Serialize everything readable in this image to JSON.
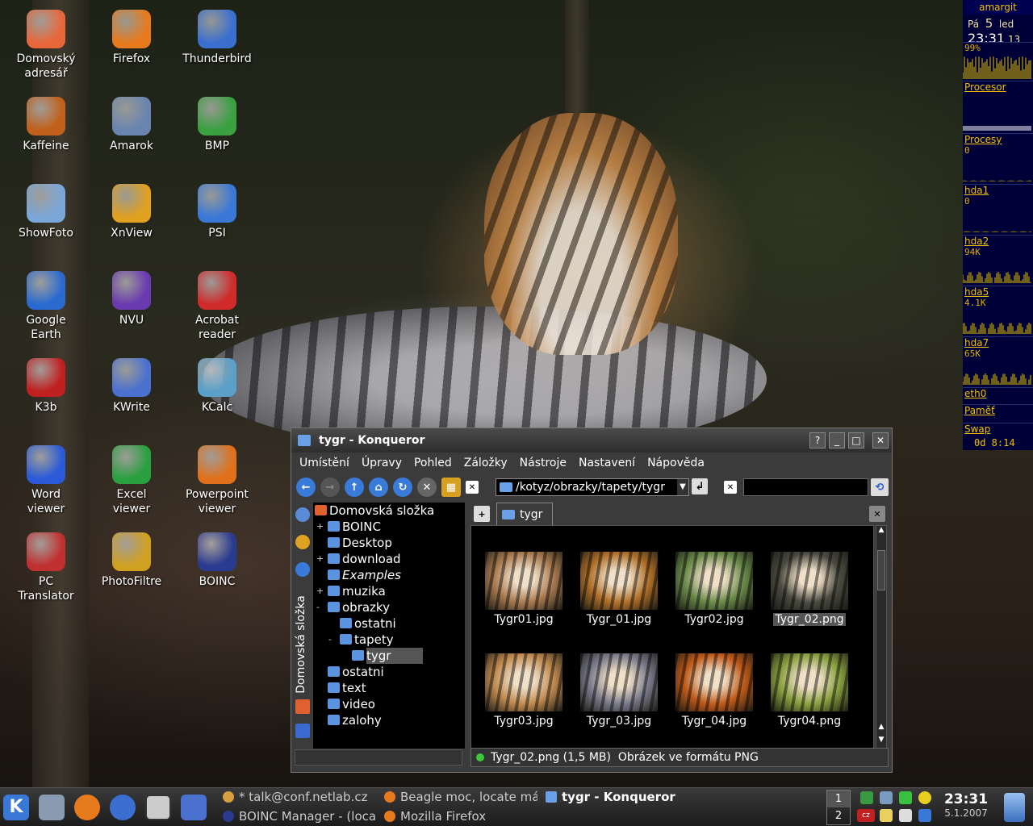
{
  "desktop": {
    "icons": [
      {
        "label": "Domovský\nadresář",
        "icon": "home-icon",
        "color": "#e8673a"
      },
      {
        "label": "Firefox",
        "icon": "firefox-icon",
        "color": "#e87a1e"
      },
      {
        "label": "Thunderbird",
        "icon": "thunderbird-icon",
        "color": "#3a6fd0"
      },
      {
        "label": "Kaffeine",
        "icon": "kaffeine-icon",
        "color": "#c0601a"
      },
      {
        "label": "Amarok",
        "icon": "amarok-icon",
        "color": "#6a84b0"
      },
      {
        "label": "BMP",
        "icon": "bmp-icon",
        "color": "#3aa040"
      },
      {
        "label": "ShowFoto",
        "icon": "showfoto-icon",
        "color": "#7aa6d8"
      },
      {
        "label": "XnView",
        "icon": "xnview-icon",
        "color": "#e0a020"
      },
      {
        "label": "PSI",
        "icon": "psi-icon",
        "color": "#3a78d8"
      },
      {
        "label": "Google\nEarth",
        "icon": "google-earth-icon",
        "color": "#2a6ad0"
      },
      {
        "label": "NVU",
        "icon": "nvu-icon",
        "color": "#6a3ab0"
      },
      {
        "label": "Acrobat\nreader",
        "icon": "acrobat-icon",
        "color": "#d02a2a"
      },
      {
        "label": "K3b",
        "icon": "k3b-icon",
        "color": "#c02020"
      },
      {
        "label": "KWrite",
        "icon": "kwrite-icon",
        "color": "#4a70d0"
      },
      {
        "label": "KCalc",
        "icon": "kcalc-icon",
        "color": "#5aa0c8"
      },
      {
        "label": "Word\nviewer",
        "icon": "word-viewer-icon",
        "color": "#2a5ad8"
      },
      {
        "label": "Excel\nviewer",
        "icon": "excel-viewer-icon",
        "color": "#2aa040"
      },
      {
        "label": "Powerpoint\nviewer",
        "icon": "powerpoint-viewer-icon",
        "color": "#e0701a"
      },
      {
        "label": "PC\nTranslator",
        "icon": "pc-translator-icon",
        "color": "#c03030"
      },
      {
        "label": "PhotoFiltre",
        "icon": "photofiltre-icon",
        "color": "#d0a020"
      },
      {
        "label": "BOINC",
        "icon": "boinc-icon",
        "color": "#2a3a90"
      }
    ]
  },
  "monitor": {
    "host": "amargit",
    "day": "Pá",
    "date_num": "5",
    "month": "led",
    "time": "23:31",
    "seconds": "13",
    "sections": [
      {
        "name": "",
        "value": "99%"
      },
      {
        "name": "Procesor",
        "value": ""
      },
      {
        "name": "Procesy",
        "value": "0"
      },
      {
        "name": "hda1",
        "value": "0"
      },
      {
        "name": "hda2",
        "value": "94K"
      },
      {
        "name": "hda5",
        "value": "4.1K"
      },
      {
        "name": "hda7",
        "value": "65K"
      },
      {
        "name": "eth0",
        "value": ""
      },
      {
        "name": "Paměť",
        "value": ""
      },
      {
        "name": "Swap",
        "value": ""
      }
    ],
    "uptime": "0d  8:14"
  },
  "window": {
    "title": "tygr - Konqueror",
    "menu": [
      "Umístění",
      "Úpravy",
      "Pohled",
      "Záložky",
      "Nástroje",
      "Nastavení",
      "Nápověda"
    ],
    "address": "/kotyz/obrazky/tapety/tygr",
    "side_label": "Domovská složka",
    "tree": [
      {
        "label": "Domovská složka",
        "exp": "",
        "level": 0
      },
      {
        "label": "BOINC",
        "exp": "+",
        "level": 1
      },
      {
        "label": "Desktop",
        "exp": "",
        "level": 1
      },
      {
        "label": "download",
        "exp": "+",
        "level": 1
      },
      {
        "label": "Examples",
        "exp": "",
        "level": 1
      },
      {
        "label": "muzika",
        "exp": "+",
        "level": 1
      },
      {
        "label": "obrazky",
        "exp": "-",
        "level": 1
      },
      {
        "label": "ostatni",
        "exp": "",
        "level": 2
      },
      {
        "label": "tapety",
        "exp": "-",
        "level": 2
      },
      {
        "label": "tygr",
        "exp": "",
        "level": 3
      },
      {
        "label": "ostatni",
        "exp": "",
        "level": 1
      },
      {
        "label": "text",
        "exp": "",
        "level": 1
      },
      {
        "label": "video",
        "exp": "",
        "level": 1
      },
      {
        "label": "zalohy",
        "exp": "",
        "level": 1
      }
    ],
    "tab_label": "tygr",
    "files": [
      {
        "name": "Tygr01.jpg",
        "tone": "#a87a50"
      },
      {
        "name": "Tygr_01.jpg",
        "tone": "#b0702a"
      },
      {
        "name": "Tygr02.jpg",
        "tone": "#6a8a4a"
      },
      {
        "name": "Tygr_02.png",
        "tone": "#4a4a40"
      },
      {
        "name": "Tygr03.jpg",
        "tone": "#c08a50"
      },
      {
        "name": "Tygr_03.jpg",
        "tone": "#7a7a8a"
      },
      {
        "name": "Tygr_04.jpg",
        "tone": "#c05a1a"
      },
      {
        "name": "Tygr04.png",
        "tone": "#8aa040"
      }
    ],
    "status": "Tygr_02.png (1,5 MB)  Obrázek ve formátu PNG"
  },
  "taskbar": {
    "tasks": [
      {
        "label": "* talk@conf.netlab.cz",
        "active": false
      },
      {
        "label": "Beagle moc, locate má",
        "active": false
      },
      {
        "label": "tygr - Konqueror",
        "active": true
      },
      {
        "label": "BOINC Manager - (local",
        "active": false
      },
      {
        "label": "Mozilla Firefox",
        "active": false
      }
    ],
    "desktops": [
      "1",
      "2"
    ],
    "clock_time": "23:31",
    "clock_date": "5.1.2007"
  }
}
